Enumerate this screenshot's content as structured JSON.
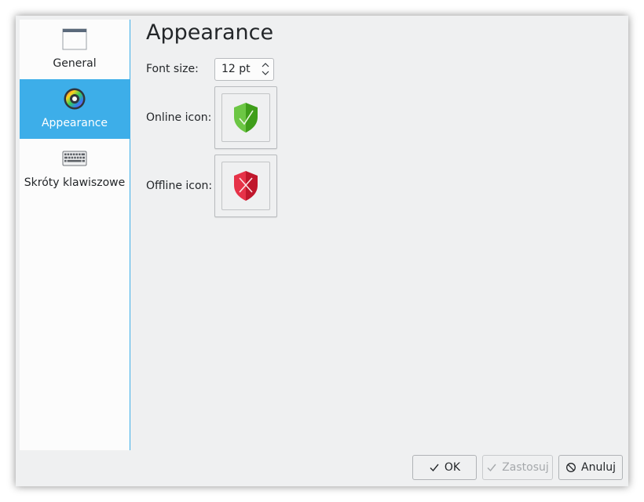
{
  "sidebar": {
    "items": [
      {
        "label": "General",
        "icon": "window-icon",
        "selected": false
      },
      {
        "label": "Appearance",
        "icon": "color-wheel-icon",
        "selected": true
      },
      {
        "label": "Skróty klawiszowe",
        "icon": "keyboard-icon",
        "selected": false
      }
    ]
  },
  "page": {
    "title": "Appearance",
    "font_size": {
      "label": "Font size:",
      "value": "12 pt"
    },
    "online_icon": {
      "label": "Online icon:",
      "icon": "shield-check-icon",
      "color": "#4caf1e"
    },
    "offline_icon": {
      "label": "Offline icon:",
      "icon": "shield-x-icon",
      "color": "#d91e34"
    }
  },
  "buttons": {
    "ok": "OK",
    "apply": "Zastosuj",
    "cancel": "Anuluj"
  },
  "colors": {
    "accent": "#3daee9",
    "background": "#eff0f1",
    "text": "#232629"
  }
}
